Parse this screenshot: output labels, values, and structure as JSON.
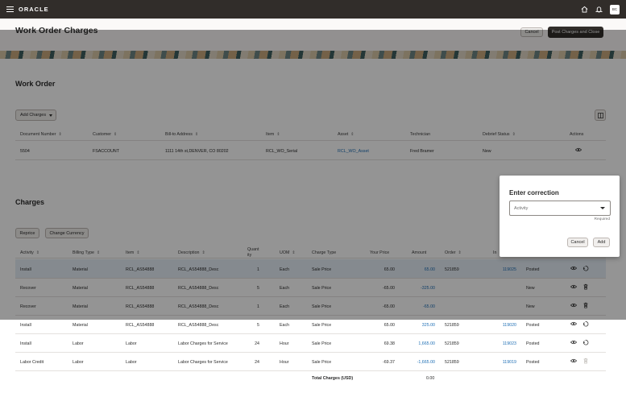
{
  "app": {
    "logo": "ORACLE",
    "avatar": "BC"
  },
  "page": {
    "title": "Work Order Charges",
    "cancel_label": "Cancel",
    "post_label": "Post Charges and Close"
  },
  "work_order": {
    "title": "Work Order",
    "add_charges_label": "Add Charges",
    "columns": [
      "Document Number",
      "Customer",
      "Bill-to Address",
      "Item",
      "Asset",
      "Technician",
      "Debrief Status",
      "Actions"
    ],
    "row": {
      "document_number": "5504",
      "customer": "FSACCOUNT",
      "bill_to": "1111 14th st,DENVER, CO 80202",
      "item": "RCL_WO_Serial",
      "asset": "RCL_WO_Asset",
      "technician": "Fred Bramer",
      "status": "New"
    }
  },
  "charges": {
    "title": "Charges",
    "reprice_label": "Reprice",
    "change_currency_label": "Change Currency",
    "columns": {
      "activity": "Activity",
      "billing_type": "Billing Type",
      "item": "Item",
      "description": "Description",
      "quantity_line1": "Quant",
      "quantity_line2": "ity",
      "uom": "UOM",
      "charge_type": "Charge Type",
      "your_price": "Your Price",
      "amount": "Amount",
      "order": "Order",
      "invoice": "In"
    },
    "rows": [
      {
        "activity": "Install",
        "billing_type": "Material",
        "item": "RCL_AS54888",
        "description": "RCL_AS54888_Desc",
        "quantity": "1",
        "uom": "Each",
        "charge_type": "Sale Price",
        "your_price": "65.00",
        "amount": "65.00",
        "order": "521859",
        "invoice": "119025",
        "status": "Posted",
        "action": "undo"
      },
      {
        "activity": "Recover",
        "billing_type": "Material",
        "item": "RCL_AS54888",
        "description": "RCL_AS54888_Desc",
        "quantity": "5",
        "uom": "Each",
        "charge_type": "Sale Price",
        "your_price": "-65.00",
        "amount": "-325.00",
        "order": "",
        "invoice": "",
        "status": "New",
        "action": "delete"
      },
      {
        "activity": "Recover",
        "billing_type": "Material",
        "item": "RCL_AS54888",
        "description": "RCL_AS54888_Desc",
        "quantity": "1",
        "uom": "Each",
        "charge_type": "Sale Price",
        "your_price": "-65.00",
        "amount": "-65.00",
        "order": "",
        "invoice": "",
        "status": "New",
        "action": "delete"
      },
      {
        "activity": "Install",
        "billing_type": "Material",
        "item": "RCL_AS54888",
        "description": "RCL_AS54888_Desc",
        "quantity": "5",
        "uom": "Each",
        "charge_type": "Sale Price",
        "your_price": "65.00",
        "amount": "325.00",
        "order": "521859",
        "invoice": "119020",
        "status": "Posted",
        "action": "undo"
      },
      {
        "activity": "Install",
        "billing_type": "Labor",
        "item": "Labor",
        "description": "Labor Charges for Service",
        "quantity": "24",
        "uom": "Hour",
        "charge_type": "Sale Price",
        "your_price": "69.38",
        "amount": "1,665.00",
        "order": "521859",
        "invoice": "119023",
        "status": "Posted",
        "action": "undo"
      },
      {
        "activity": "Labor Credit",
        "billing_type": "Labor",
        "item": "Labor",
        "description": "Labor Charges for Service",
        "quantity": "24",
        "uom": "Hour",
        "charge_type": "Sale Price",
        "your_price": "-69.37",
        "amount": "-1,665.00",
        "order": "521859",
        "invoice": "119019",
        "status": "Posted",
        "action": "delete-disabled"
      }
    ],
    "total_label": "Total Charges (USD)",
    "total_value": "0.00"
  },
  "dialog": {
    "title": "Enter correction",
    "select_value": "Activity",
    "required_label": "Required",
    "cancel_label": "Cancel",
    "add_label": "Add"
  }
}
